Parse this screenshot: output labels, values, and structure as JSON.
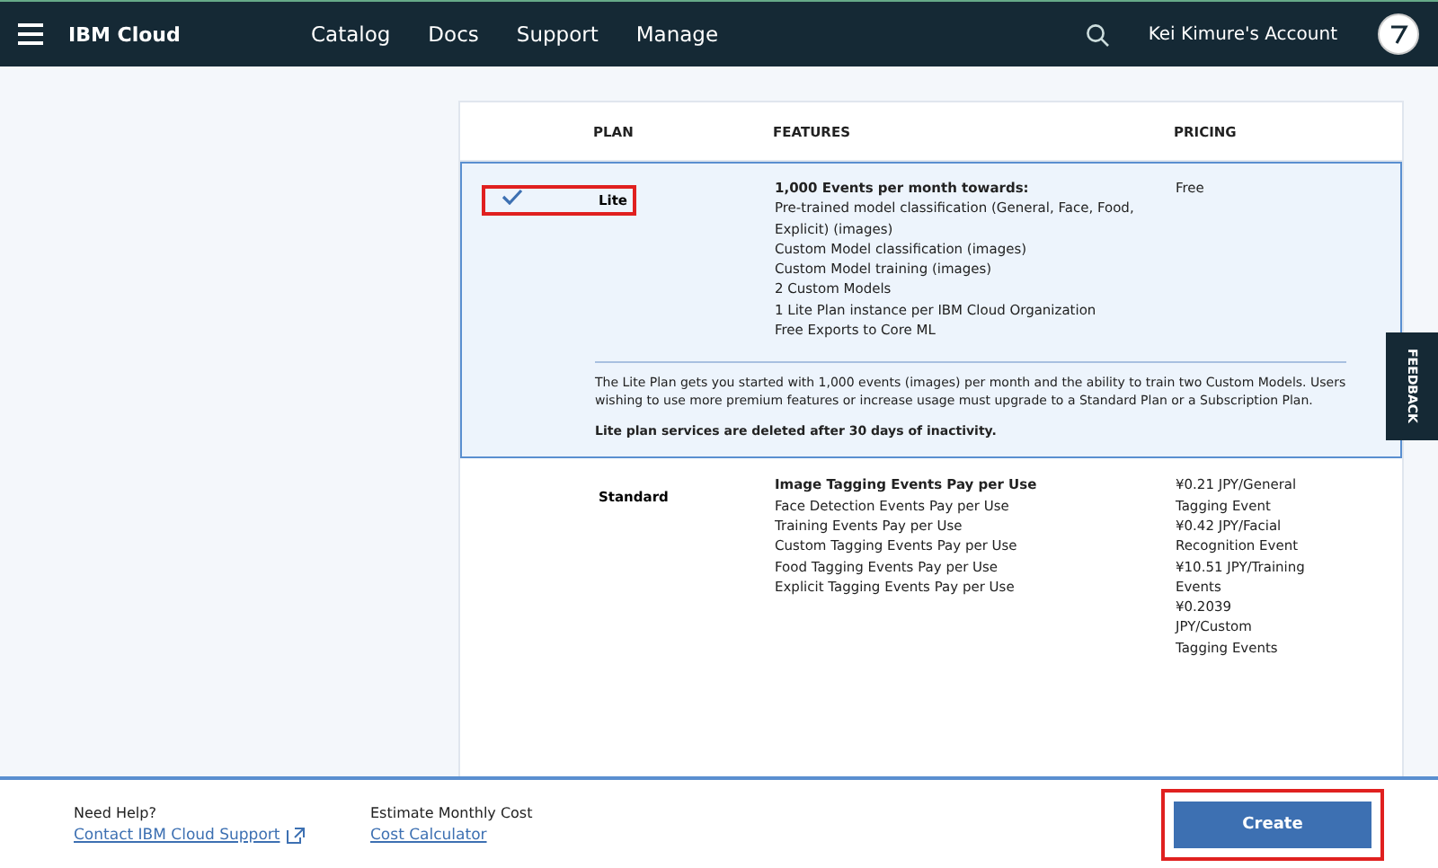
{
  "header": {
    "brand": "IBM Cloud",
    "nav": [
      "Catalog",
      "Docs",
      "Support",
      "Manage"
    ],
    "account": "Kei Kimure's Account"
  },
  "table": {
    "columns": [
      "PLAN",
      "FEATURES",
      "PRICING"
    ],
    "rows": [
      {
        "selected": true,
        "highlighted": true,
        "plan": "Lite",
        "features_title": "1,000 Events per month towards:",
        "features": [
          "Pre-trained model classification (General, Face, Food, Explicit) (images)",
          "Custom Model classification (images)",
          "Custom Model training (images)",
          "2 Custom Models",
          "1 Lite Plan instance per IBM Cloud Organization",
          "Free Exports to Core ML"
        ],
        "pricing": [
          "Free"
        ],
        "description": "The Lite Plan gets you started with 1,000 events (images) per month and the ability to train two Custom Models. Users wishing to use more premium features or increase usage must upgrade to a Standard Plan or a Subscription Plan.",
        "note": "Lite plan services are deleted after 30 days of inactivity."
      },
      {
        "selected": false,
        "highlighted": false,
        "plan": "Standard",
        "features_title": "Image Tagging Events Pay per Use",
        "features": [
          "Face Detection Events Pay per Use",
          "Training Events Pay per Use",
          "Custom Tagging Events Pay per Use",
          "Food Tagging Events Pay per Use",
          "Explicit Tagging Events Pay per Use"
        ],
        "pricing": [
          "¥0.21 JPY/General Tagging Event",
          "¥0.42 JPY/Facial Recognition Event",
          "¥10.51 JPY/Training Events",
          "¥0.2039 JPY/Custom Tagging Events"
        ]
      }
    ]
  },
  "feedback": "FEEDBACK",
  "footer": {
    "help_label": "Need Help?",
    "help_link": "Contact IBM Cloud Support",
    "cost_label": "Estimate Monthly Cost",
    "cost_link": "Cost Calculator",
    "button": {
      "label": "Create",
      "highlighted": true
    }
  }
}
